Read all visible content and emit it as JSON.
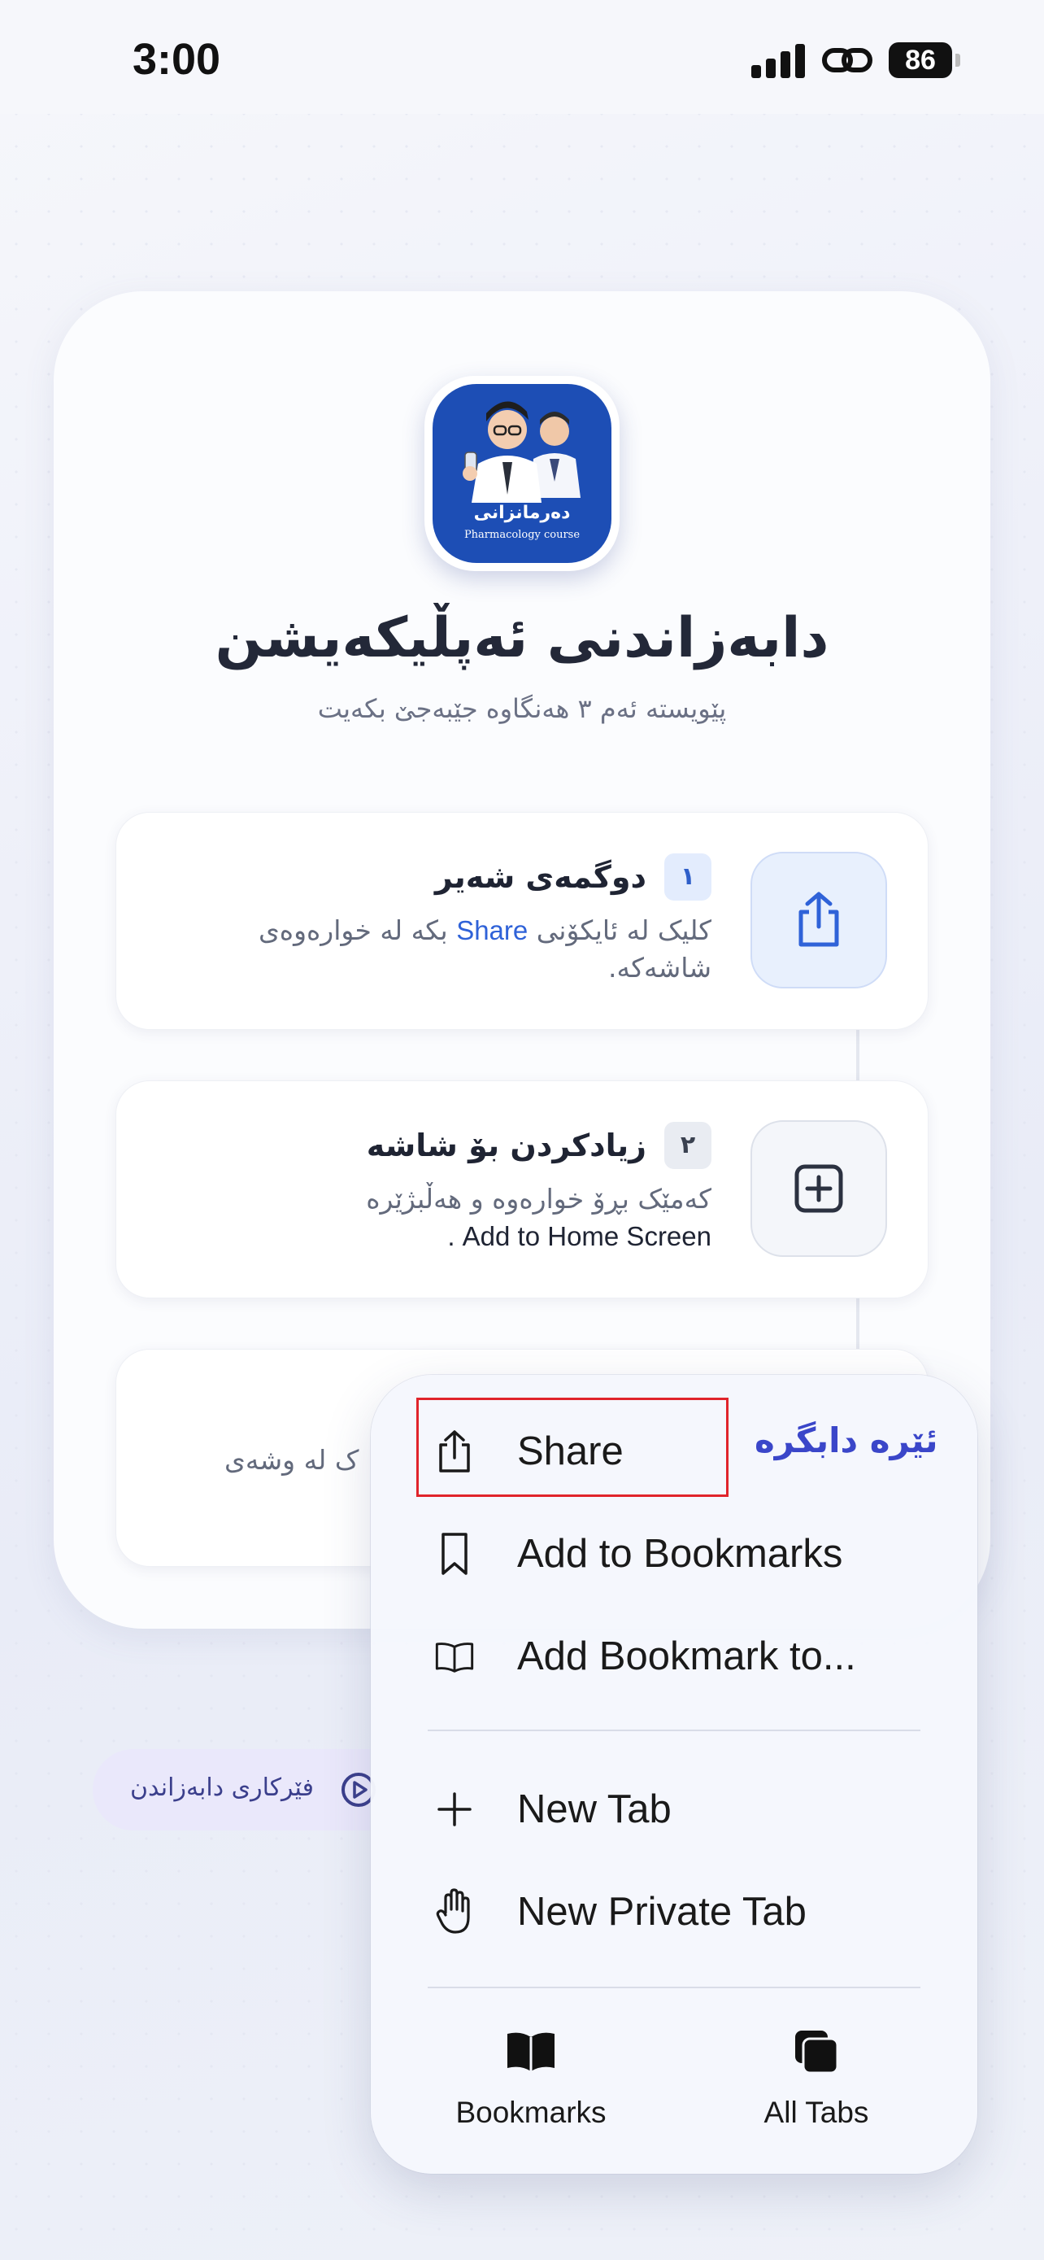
{
  "status_bar": {
    "time": "3:00",
    "battery": "86"
  },
  "app_icon": {
    "title": "دەرمانزانی",
    "subtitle": "Pharmacology course"
  },
  "header": {
    "title": "دابەزاندنی ئەپڵیکەیشن",
    "subtitle": "پێویستە ئەم ٣ هەنگاوە جێبەجێ بکەیت"
  },
  "steps": [
    {
      "number": "١",
      "title": "دوگمەی شەیر",
      "desc_prefix": "کلیک لە ئایکۆنی",
      "desc_highlight": "Share",
      "desc_suffix": "بکە لە خوارەوەی شاشەکە.",
      "icon": "share-icon"
    },
    {
      "number": "٢",
      "title": "زیادکردن بۆ شاشە",
      "desc_line1": "کەمێک بڕۆ خوارەوە و هەڵبژێرە",
      "desc_line2": "Add to Home Screen .",
      "icon": "plus-square-icon"
    },
    {
      "partial_text": "ک لە وشەی"
    }
  ],
  "tutorial_pill": {
    "label": "فێرکاری دابەزاندن",
    "icon": "play-icon"
  },
  "menu": {
    "items": [
      {
        "label": "Share",
        "icon": "share-icon"
      },
      {
        "label": "Add to Bookmarks",
        "icon": "bookmark-icon"
      },
      {
        "label": "Add Bookmark to...",
        "icon": "book-open-icon"
      },
      {
        "label": "New Tab",
        "icon": "plus-icon"
      },
      {
        "label": "New Private Tab",
        "icon": "hand-icon"
      }
    ],
    "hint": "ئێرە دابگرە",
    "bottom": [
      {
        "label": "Bookmarks",
        "icon": "bookmarks-icon"
      },
      {
        "label": "All Tabs",
        "icon": "all-tabs-icon"
      }
    ]
  },
  "colors": {
    "accent": "#2f62d8",
    "highlight_border": "#e0242b",
    "hint": "#3a46c9",
    "app_icon_bg": "#1d4eb5"
  }
}
